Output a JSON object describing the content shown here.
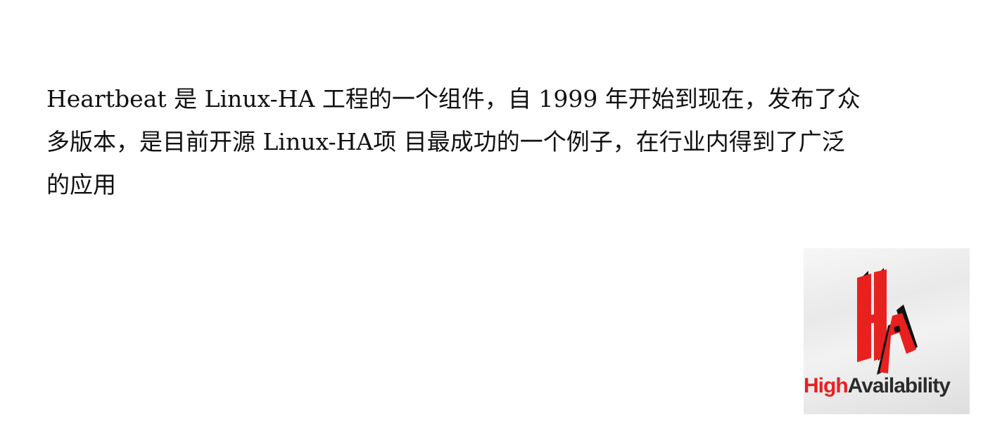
{
  "paragraph": {
    "lines": [
      "Heartbeat 是 Linux-HA 工程的一个组件，自 1999 年开始到现在，发布了众",
      "多版本，是目前开源 Linux-HA项 目最成功的一个例子，在行业内得到了广泛",
      "的应用"
    ]
  },
  "logo": {
    "mark": "HA",
    "word_1": "High",
    "word_2": "Availability",
    "colors": {
      "red": "#e8211f",
      "dark": "#2b2b2b"
    }
  }
}
